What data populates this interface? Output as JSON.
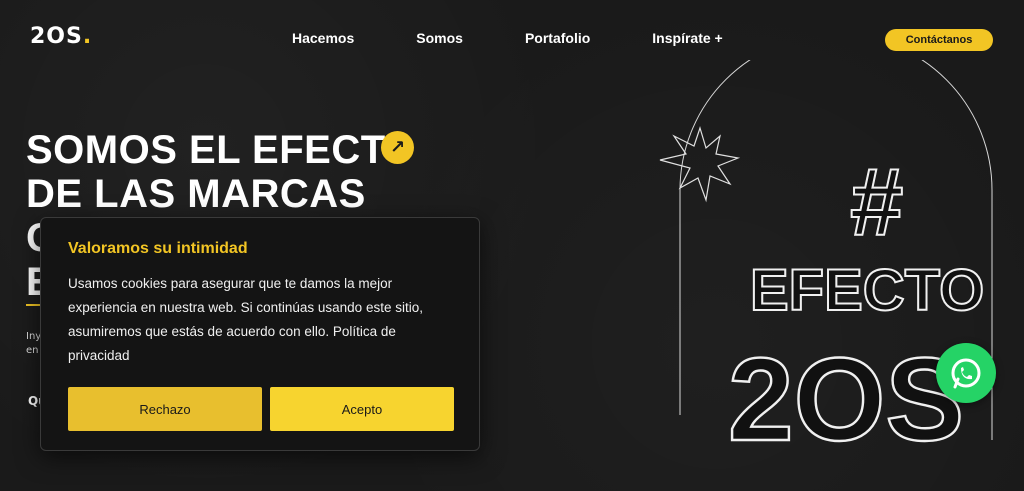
{
  "logo": {
    "text": "2OS",
    "dot": "."
  },
  "nav": {
    "items": [
      "Hacemos",
      "Somos",
      "Portafolio",
      "Inspírate +"
    ]
  },
  "contact_label": "Contáctanos",
  "hero": {
    "line1": "SOMOS EL EFECT",
    "line2": "DE LAS MARCAS",
    "line3": "C",
    "line4": "E",
    "sub1": "Iny",
    "sub2": "en",
    "question": "Qu"
  },
  "art": {
    "line1": "#",
    "line2": "EFECTO",
    "line3": "2OS"
  },
  "cookie": {
    "title": "Valoramos su intimidad",
    "body": "Usamos cookies para asegurar que te damos la mejor experiencia en nuestra web. Si continúas usando este sitio, asumiremos que estás de acuerdo con ello. Política de privacidad",
    "reject_label": "Rechazo",
    "accept_label": "Acepto"
  },
  "colors": {
    "accent": "#f2c524",
    "background": "#1a1a1a",
    "whatsapp": "#25d366"
  },
  "icons": {
    "hero_arrow": "arrow-up-right-icon",
    "whatsapp": "whatsapp-icon"
  }
}
